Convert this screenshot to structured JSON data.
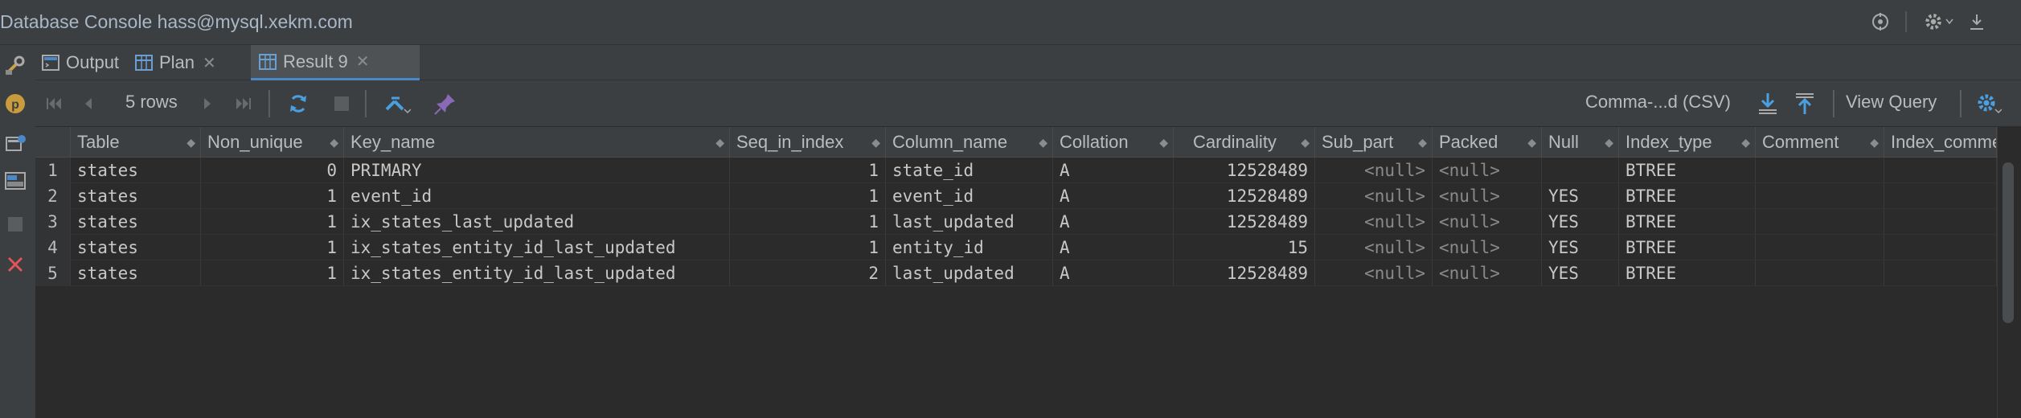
{
  "window": {
    "title": "Database Console hass@mysql.xekm.com"
  },
  "title_icons": [
    "crosshair-icon",
    "gear-icon",
    "download-icon"
  ],
  "tabs": [
    {
      "label": "Output",
      "icon": "console-icon",
      "closable": false,
      "active": false
    },
    {
      "label": "Plan",
      "icon": "table-icon",
      "closable": true,
      "active": false
    },
    {
      "label": "Result 9",
      "icon": "table-icon",
      "closable": true,
      "active": true
    }
  ],
  "toolbar": {
    "rows_label": "5 rows",
    "format_label": "Comma-...d (CSV)",
    "view_query_label": "View Query"
  },
  "table": {
    "columns": [
      "Table",
      "Non_unique",
      "Key_name",
      "Seq_in_index",
      "Column_name",
      "Collation",
      "Cardinality",
      "Sub_part",
      "Packed",
      "Null",
      "Index_type",
      "Comment",
      "Index_comment"
    ],
    "rows": [
      {
        "n": "1",
        "Table": "states",
        "Non_unique": "0",
        "Key_name": "PRIMARY",
        "Seq_in_index": "1",
        "Column_name": "state_id",
        "Collation": "A",
        "Cardinality": "12528489",
        "Sub_part": "<null>",
        "Packed": "<null>",
        "Null": "",
        "Index_type": "BTREE",
        "Comment": "",
        "Index_comment": ""
      },
      {
        "n": "2",
        "Table": "states",
        "Non_unique": "1",
        "Key_name": "event_id",
        "Seq_in_index": "1",
        "Column_name": "event_id",
        "Collation": "A",
        "Cardinality": "12528489",
        "Sub_part": "<null>",
        "Packed": "<null>",
        "Null": "YES",
        "Index_type": "BTREE",
        "Comment": "",
        "Index_comment": ""
      },
      {
        "n": "3",
        "Table": "states",
        "Non_unique": "1",
        "Key_name": "ix_states_last_updated",
        "Seq_in_index": "1",
        "Column_name": "last_updated",
        "Collation": "A",
        "Cardinality": "12528489",
        "Sub_part": "<null>",
        "Packed": "<null>",
        "Null": "YES",
        "Index_type": "BTREE",
        "Comment": "",
        "Index_comment": ""
      },
      {
        "n": "4",
        "Table": "states",
        "Non_unique": "1",
        "Key_name": "ix_states_entity_id_last_updated",
        "Seq_in_index": "1",
        "Column_name": "entity_id",
        "Collation": "A",
        "Cardinality": "15",
        "Sub_part": "<null>",
        "Packed": "<null>",
        "Null": "YES",
        "Index_type": "BTREE",
        "Comment": "",
        "Index_comment": ""
      },
      {
        "n": "5",
        "Table": "states",
        "Non_unique": "1",
        "Key_name": "ix_states_entity_id_last_updated",
        "Seq_in_index": "2",
        "Column_name": "last_updated",
        "Collation": "A",
        "Cardinality": "12528489",
        "Sub_part": "<null>",
        "Packed": "<null>",
        "Null": "YES",
        "Index_type": "BTREE",
        "Comment": "",
        "Index_comment": ""
      }
    ]
  },
  "colors": {
    "accent": "#4a88c7",
    "background": "#2b2b2b",
    "panel": "#3c3f41",
    "null_text": "#8a8a8a",
    "error_red": "#e05555"
  }
}
